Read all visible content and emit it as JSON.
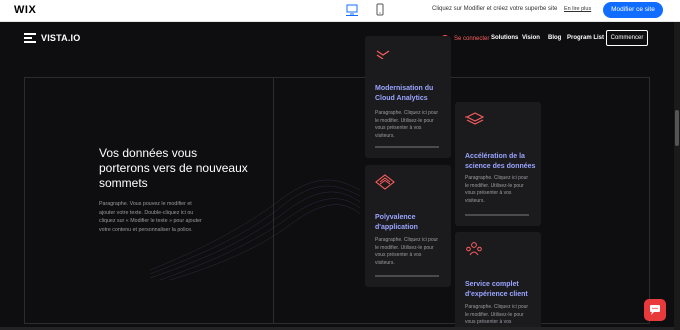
{
  "wix_bar": {
    "logo": "WIX",
    "message": "Cliquez sur Modifier et créez votre superbe site",
    "learn_more": "En lire plus",
    "edit_button": "Modifier ce site"
  },
  "header": {
    "logo": "VISTA.IO",
    "connect": "Se connecter",
    "nav": [
      "Solutions",
      "Vision",
      "Blog",
      "Program List"
    ],
    "start_button": "Commencer"
  },
  "hero": {
    "title": "Vos données vous porterons vers de nouveaux sommets",
    "paragraph": "Paragraphe. Vous pouvez le modifier et ajouter votre texte. Double-cliquez ici ou cliquez sur « Modifier le texte » pour ajouter votre contenu et personnaliser la police."
  },
  "cards": [
    {
      "title": "Modernisation du Cloud Analytics",
      "text": "Paragraphe. Cliquez ici pour le modifier. Utilisez-le pour vous présenter à vos visiteurs."
    },
    {
      "title": "Accélération de la science des données",
      "text": "Paragraphe. Cliquez ici pour le modifier. Utilisez-le pour vous présenter à vos visiteurs."
    },
    {
      "title": "Polyvalence d'application",
      "text": "Paragraphe. Cliquez ici pour le modifier. Utilisez-le pour vous présenter à vos visiteurs."
    },
    {
      "title": "Service complet d'expérience client",
      "text": "Paragraphe. Cliquez ici pour le modifier. Utilisez-le pour vous présenter à vos"
    }
  ],
  "colors": {
    "background": "#0e0e10",
    "card": "#1b1b1e",
    "accent": "#ff5e5e",
    "card_title": "#9aa5ff",
    "wix_blue": "#116dff"
  },
  "icons": [
    "desktop-icon",
    "mobile-icon",
    "user-avatar-icon",
    "cloud-stack-icon",
    "layers-icon",
    "diamond-layers-icon",
    "people-icon",
    "chat-icon"
  ]
}
